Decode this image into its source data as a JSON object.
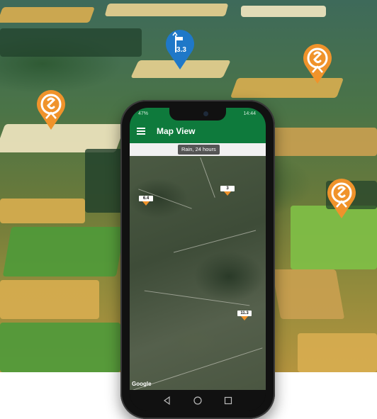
{
  "markers": [
    {
      "icon": "sensor-marker-icon",
      "color": "#f0932b"
    },
    {
      "icon": "weather-station-marker-icon",
      "color": "#1f78c8",
      "value": "3.3"
    },
    {
      "icon": "sensor-marker-icon",
      "color": "#f0932b"
    },
    {
      "icon": "sensor-marker-icon",
      "color": "#f0932b"
    }
  ],
  "phone": {
    "status": {
      "battery": "47%",
      "time": "14:44"
    },
    "app_bar": {
      "title": "Map View",
      "accent": "#0e7a3c"
    },
    "chip": "Rain, 24 hours",
    "map": {
      "attribution": "Google",
      "rain_tags": [
        {
          "value": "6.4"
        },
        {
          "value": "3"
        },
        {
          "value": "11.3"
        }
      ]
    }
  }
}
